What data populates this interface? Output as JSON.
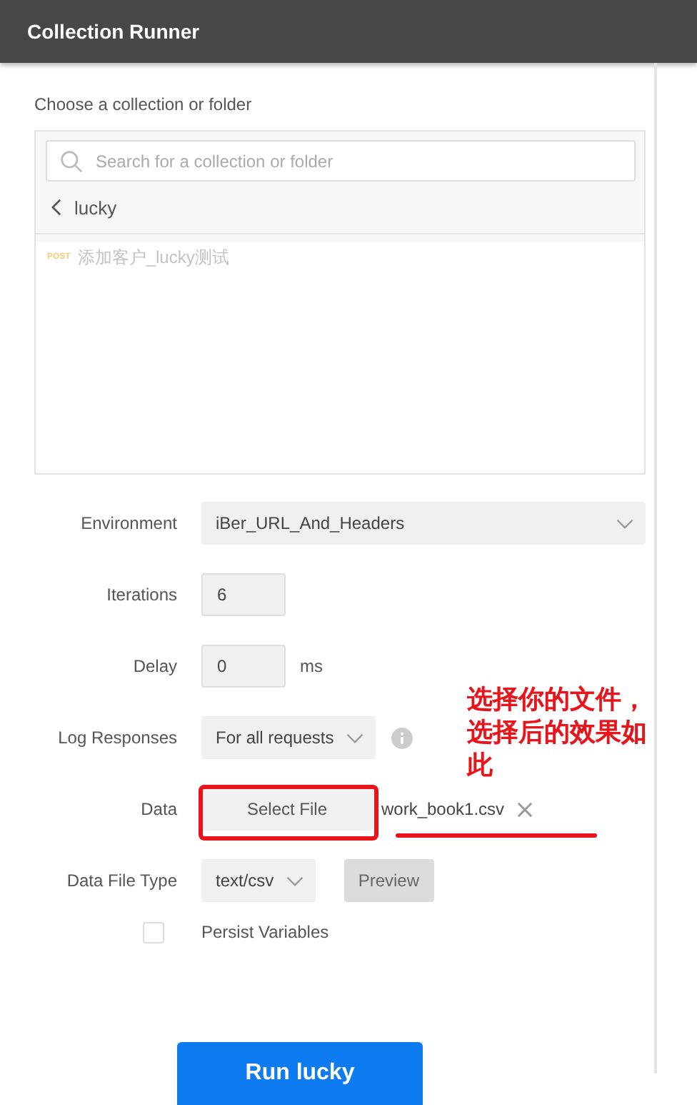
{
  "window": {
    "title": "Collection Runner"
  },
  "collection": {
    "label": "Choose a collection or folder",
    "search": {
      "placeholder": "Search for a collection or folder"
    },
    "folder": "lucky",
    "requests": [
      {
        "method": "POST",
        "name": "添加客户_lucky测试"
      }
    ]
  },
  "form": [
    {
      "kind": "wide-select",
      "label": "Environment",
      "value": "iBer_URL_And_Headers"
    },
    {
      "kind": "input",
      "label": "Iterations",
      "value": "6"
    },
    {
      "kind": "input",
      "label": "Delay",
      "value": "0",
      "unit": "ms"
    },
    {
      "kind": "select",
      "label": "Log Responses",
      "value": "For all requests",
      "info": true
    },
    {
      "kind": "file",
      "label": "Data",
      "button": "Select File",
      "file": "work_book1.csv"
    },
    {
      "kind": "select",
      "label": "Data File Type",
      "value": "text/csv",
      "button": "Preview"
    },
    {
      "kind": "checkbox",
      "label": "Persist Variables",
      "checked": false
    }
  ],
  "run_button": "Run lucky",
  "annotation": {
    "text": "选择你的文件，选择后的效果如此"
  }
}
